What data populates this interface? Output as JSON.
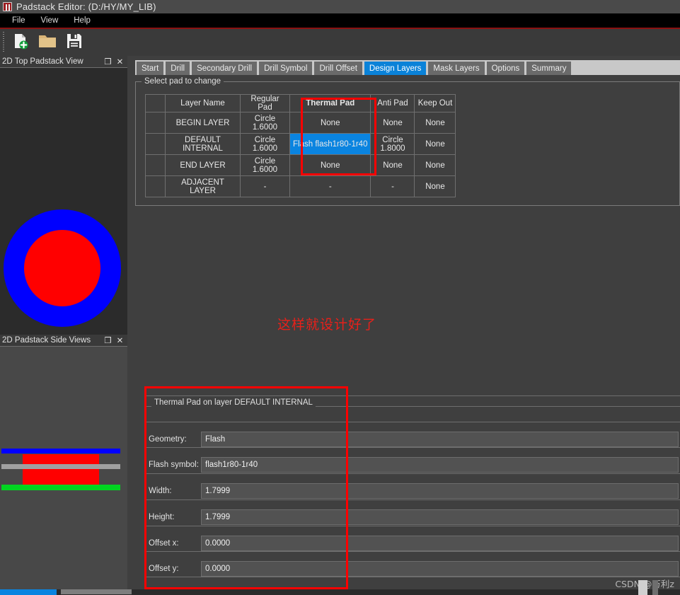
{
  "window": {
    "title": "Padstack Editor:   (D:/HY/MY_LIB)",
    "icon": "padstack-editor-icon"
  },
  "menubar": {
    "items": [
      {
        "label": "File"
      },
      {
        "label": "View"
      },
      {
        "label": "Help"
      }
    ]
  },
  "toolbar": {
    "buttons": [
      {
        "name": "new-file-icon",
        "label": "New"
      },
      {
        "name": "open-folder-icon",
        "label": "Open"
      },
      {
        "name": "save-disk-icon",
        "label": "Save"
      }
    ]
  },
  "docks": {
    "top_view": {
      "title": "2D Top Padstack View",
      "float_label": "❐",
      "close_label": "✕",
      "graphic": {
        "outer_color": "#0000ff",
        "inner_color": "#ff0000",
        "background": "#2b2b2b"
      }
    },
    "side_view": {
      "title": "2D Padstack Side Views",
      "float_label": "❐",
      "close_label": "✕",
      "graphic": {
        "background": "#484848",
        "blue_bar": "#0000ff",
        "red_pad": "#ff0000",
        "gray_bar": "#a0a0a0",
        "green_bar": "#00d420"
      }
    }
  },
  "tabs": [
    {
      "label": "Start",
      "active": false
    },
    {
      "label": "Drill",
      "active": false
    },
    {
      "label": "Secondary Drill",
      "active": false
    },
    {
      "label": "Drill Symbol",
      "active": false
    },
    {
      "label": "Drill Offset",
      "active": false
    },
    {
      "label": "Design Layers",
      "active": true
    },
    {
      "label": "Mask Layers",
      "active": false
    },
    {
      "label": "Options",
      "active": false
    },
    {
      "label": "Summary",
      "active": false
    }
  ],
  "pad_group": {
    "legend": "Select pad to change",
    "columns": [
      "",
      "Layer Name",
      "Regular Pad",
      "Thermal Pad",
      "Anti Pad",
      "Keep Out"
    ],
    "rows": [
      {
        "selector": "",
        "layer_name": "BEGIN LAYER",
        "regular_pad": "Circle 1.6000",
        "thermal_pad": "None",
        "anti_pad": "None",
        "keep_out": "None",
        "dim": false,
        "selected": false
      },
      {
        "selector": "",
        "layer_name": "DEFAULT INTERNAL",
        "regular_pad": "Circle 1.6000",
        "thermal_pad": "Flash flash1r80-1r40",
        "anti_pad": "Circle 1.8000",
        "keep_out": "None",
        "dim": true,
        "selected": true
      },
      {
        "selector": "",
        "layer_name": "END LAYER",
        "regular_pad": "Circle 1.6000",
        "thermal_pad": "None",
        "anti_pad": "None",
        "keep_out": "None",
        "dim": false,
        "selected": false
      },
      {
        "selector": "",
        "layer_name": "ADJACENT LAYER",
        "regular_pad": "-",
        "thermal_pad": "-",
        "anti_pad": "-",
        "keep_out": "None",
        "dim": true,
        "selected": false
      }
    ]
  },
  "detail_form": {
    "legend": "Thermal Pad on layer DEFAULT INTERNAL",
    "fields": [
      {
        "label": "Geometry:",
        "value": "Flash"
      },
      {
        "label": "Flash symbol:",
        "value": "flash1r80-1r40"
      },
      {
        "label": "Width:",
        "value": "1.7999"
      },
      {
        "label": "Height:",
        "value": "1.7999"
      },
      {
        "label": "Offset x:",
        "value": "0.0000"
      },
      {
        "label": "Offset y:",
        "value": "0.0000"
      }
    ]
  },
  "annotations": {
    "chinese_note": "这样就设计好了",
    "watermark": "CSDN @万利z",
    "highlight_color": "#ff0000"
  }
}
